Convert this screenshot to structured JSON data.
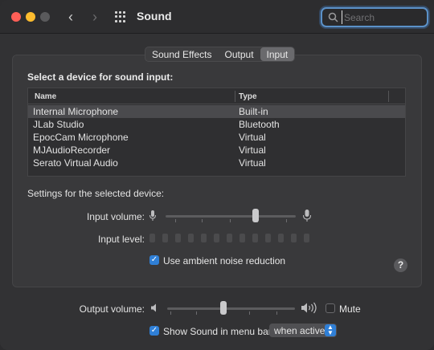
{
  "window": {
    "title": "Sound"
  },
  "search": {
    "placeholder": "Search"
  },
  "tabs": [
    {
      "label": "Sound Effects",
      "active": false
    },
    {
      "label": "Output",
      "active": false
    },
    {
      "label": "Input",
      "active": true
    }
  ],
  "input": {
    "section_title": "Select a device for sound input:",
    "table": {
      "columns": [
        "Name",
        "Type"
      ],
      "rows": [
        {
          "name": "Internal Microphone",
          "type": "Built-in",
          "selected": true
        },
        {
          "name": "JLab Studio",
          "type": "Bluetooth",
          "selected": false
        },
        {
          "name": "EpocCam Microphone",
          "type": "Virtual",
          "selected": false
        },
        {
          "name": "MJAudioRecorder",
          "type": "Virtual",
          "selected": false
        },
        {
          "name": "Serato Virtual Audio",
          "type": "Virtual",
          "selected": false
        }
      ]
    },
    "settings_label": "Settings for the selected device:",
    "input_volume_label": "Input volume:",
    "input_volume": 0.69,
    "input_level_label": "Input level:",
    "ambient_noise_label": "Use ambient noise reduction",
    "ambient_noise_checked": true
  },
  "footer": {
    "output_volume_label": "Output volume:",
    "output_volume": 0.44,
    "mute_label": "Mute",
    "mute_checked": false,
    "menu_bar_label": "Show Sound in menu bar",
    "menu_bar_checked": true,
    "menu_bar_option": "when active"
  },
  "colors": {
    "accent": "#2f7fd6",
    "focus_ring": "#5b91c8"
  },
  "icons": {
    "help": "?",
    "check": "✓"
  }
}
